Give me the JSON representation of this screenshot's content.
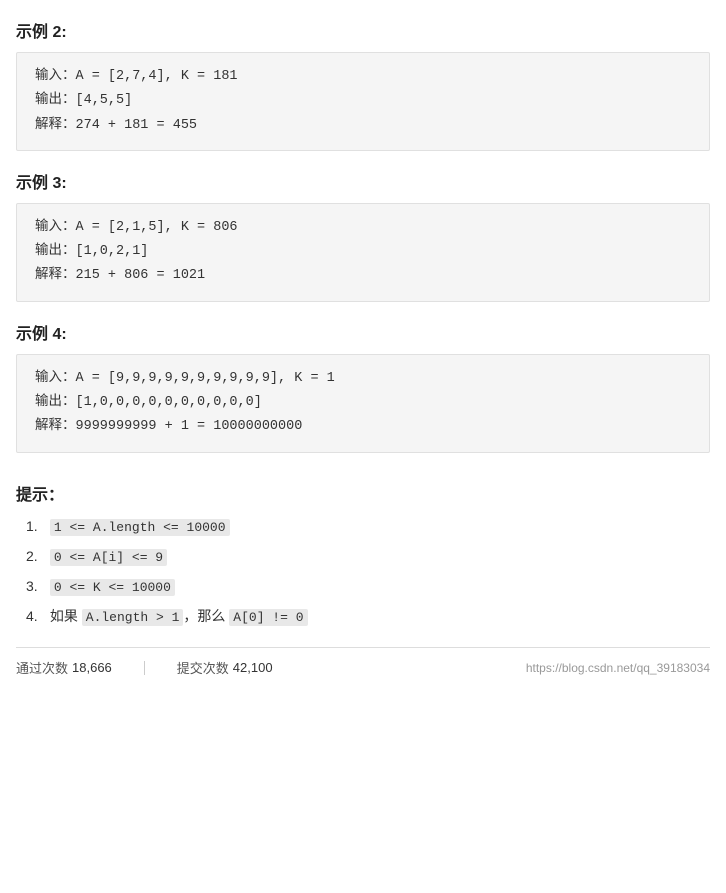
{
  "examples": [
    {
      "id": "example2",
      "title": "示例 2:",
      "input": "输入：A = [2,7,4], K = 181",
      "output": "输出：[4,5,5]",
      "explanation": "解释：274 + 181 = 455"
    },
    {
      "id": "example3",
      "title": "示例 3:",
      "input": "输入：A = [2,1,5], K = 806",
      "output": "输出：[1,0,2,1]",
      "explanation": "解释：215 + 806 = 1021"
    },
    {
      "id": "example4",
      "title": "示例 4:",
      "input": "输入：A = [9,9,9,9,9,9,9,9,9,9], K = 1",
      "output": "输出：[1,0,0,0,0,0,0,0,0,0,0]",
      "explanation": "解释：9999999999 + 1 = 10000000000"
    }
  ],
  "hints": {
    "title": "提示：",
    "items": [
      {
        "num": "1.",
        "prefix": "",
        "code": "1 <= A.length <= 10000",
        "suffix": ""
      },
      {
        "num": "2.",
        "prefix": "",
        "code": "0 <= A[i] <= 9",
        "suffix": ""
      },
      {
        "num": "3.",
        "prefix": "",
        "code": "0 <= K <= 10000",
        "suffix": ""
      },
      {
        "num": "4.",
        "prefix": "如果 ",
        "code1": "A.length > 1",
        "middle": "，那么 ",
        "code2": "A[0] != 0",
        "suffix": ""
      }
    ]
  },
  "footer": {
    "pass_label": "通过次数",
    "pass_value": "18,666",
    "submit_label": "提交次数",
    "submit_value": "42,100",
    "link_text": "https://blog.csdn.net/qq_39183034"
  }
}
